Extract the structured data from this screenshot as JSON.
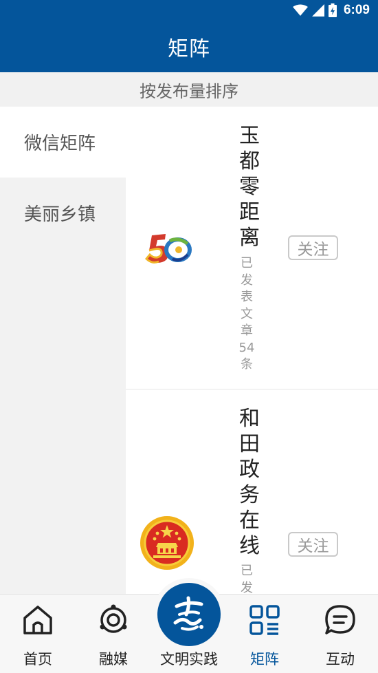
{
  "status_bar": {
    "time": "6:09",
    "icons": [
      "wifi-icon",
      "signal-icon",
      "battery-icon"
    ]
  },
  "header": {
    "title": "矩阵"
  },
  "sort_bar": {
    "label": "按发布量排序"
  },
  "sidebar": {
    "items": [
      {
        "label": "微信矩阵",
        "active": true
      },
      {
        "label": "美丽乡镇",
        "active": false
      }
    ]
  },
  "accounts": [
    {
      "name": "玉都零距离",
      "stat": "已发表文章54条",
      "follow_label": "关注",
      "logo": "anniversary-50-logo"
    },
    {
      "name": "和田政务在线",
      "stat": "已发",
      "follow_label": "关注",
      "logo": "national-emblem-logo"
    }
  ],
  "tab_bar": {
    "tabs": [
      {
        "label": "首页",
        "icon": "home-icon",
        "active": false
      },
      {
        "label": "融媒",
        "icon": "media-icon",
        "active": false
      },
      {
        "label": "文明实践",
        "icon": "civilization-practice-icon",
        "active": false
      },
      {
        "label": "矩阵",
        "icon": "matrix-icon",
        "active": true
      },
      {
        "label": "互动",
        "icon": "chat-icon",
        "active": false
      }
    ]
  },
  "colors": {
    "brand_blue": "#04559b",
    "sidebar_bg": "#f2f2f2",
    "button_border": "#c9c9c9",
    "muted_text": "#999999"
  }
}
